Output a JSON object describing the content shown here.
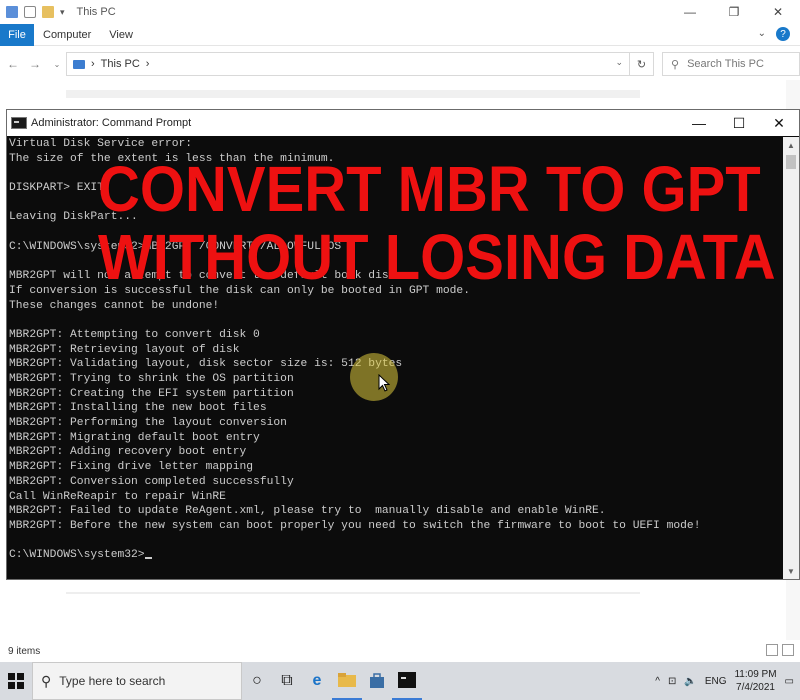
{
  "explorer": {
    "title": "This PC",
    "window_controls": [
      "—",
      "❐",
      "✕"
    ],
    "ribbon": {
      "file_tab": "File",
      "tabs": [
        "Computer",
        "View"
      ]
    },
    "address": {
      "path_separator": "›",
      "path": "This PC",
      "path_trail": "›"
    },
    "search": {
      "placeholder": "Search This PC"
    },
    "status": {
      "item_count": "9 items"
    }
  },
  "cmd": {
    "title": "Administrator: Command Prompt",
    "controls": [
      "—",
      "☐",
      "✕"
    ],
    "lines": [
      "Virtual Disk Service error:",
      "The size of the extent is less than the minimum.",
      "",
      "DISKPART> EXIT",
      "",
      "Leaving DiskPart...",
      "",
      "C:\\WINDOWS\\system32>MBR2GPT /CONVERT /ALLOWFULLOS",
      "",
      "MBR2GPT will now attempt to convert the default book disk.",
      "If conversion is successful the disk can only be booted in GPT mode.",
      "These changes cannot be undone!",
      "",
      "MBR2GPT: Attempting to convert disk 0",
      "MBR2GPT: Retrieving layout of disk",
      "MBR2GPT: Validating layout, disk sector size is: 512 bytes",
      "MBR2GPT: Trying to shrink the OS partition",
      "MBR2GPT: Creating the EFI system partition",
      "MBR2GPT: Installing the new boot files",
      "MBR2GPT: Performing the layout conversion",
      "MBR2GPT: Migrating default boot entry",
      "MBR2GPT: Adding recovery boot entry",
      "MBR2GPT: Fixing drive letter mapping",
      "MBR2GPT: Conversion completed successfully",
      "Call WinReReapir to repair WinRE",
      "MBR2GPT: Failed to update ReAgent.xml, please try to  manually disable and enable WinRE.",
      "MBR2GPT: Before the new system can boot properly you need to switch the firmware to boot to UEFI mode!",
      "",
      "C:\\WINDOWS\\system32>"
    ]
  },
  "overlay": {
    "line1": "CONVERT MBR TO GPT",
    "line2": "WITHOUT LOSING DATA",
    "color": "#ee1111"
  },
  "taskbar": {
    "search_placeholder": "Type here to search",
    "language": "ENG",
    "time": "11:09 PM",
    "date": "7/4/2021",
    "icons": [
      "windows-start-icon",
      "cortana-icon",
      "task-view-icon",
      "edge-icon",
      "file-explorer-icon",
      "store-icon",
      "cmd-icon"
    ]
  },
  "colors": {
    "accent": "#1979ca",
    "console_bg": "#0c0c0c",
    "console_text": "#cccccc"
  }
}
